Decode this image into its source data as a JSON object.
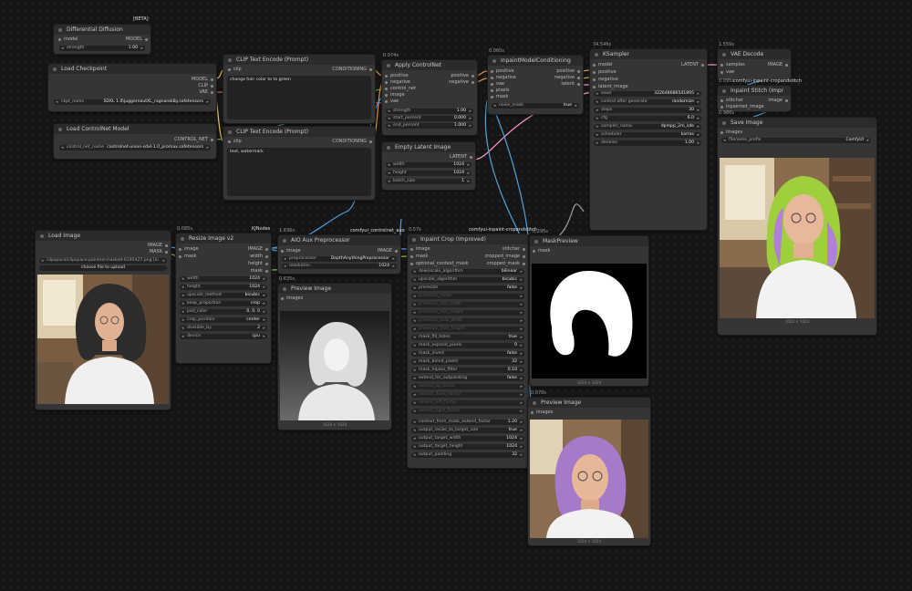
{
  "canvas": {
    "background": "#161616"
  },
  "beta_tag": "[BETA]",
  "tags": {
    "controlnet_node": "ControlNet",
    "kjnodes": "KJNodes",
    "comfyui_controlnet_aux": "comfyui_controlnet_aux",
    "comfyui_inpaint_cropandstitch": "comfyui-inpaint-cropandstitch",
    "comfyui_inpaint_cropandstitch_2": "comfyui-inpaint-cropandstitch"
  },
  "timings": {
    "resize": "0.085s",
    "aio": "1.836s",
    "inpaint_crop": "0.57s",
    "mask_preview": "0.295s",
    "preview_image": "0.635s",
    "ksampler": "34.546s",
    "vae_decode": "1.559s",
    "stitch": "0.095s",
    "save": "0.986s",
    "apply_cn": "0.074s",
    "inpaint_cond": "0.060s",
    "preview_bottom": "0.070s"
  },
  "nodes": {
    "differential": {
      "title": "Differential Diffusion",
      "in_model": "model",
      "out_model": "MODEL",
      "strength_label": "strength",
      "strength_value": "1.00"
    },
    "load_checkpoint": {
      "title": "Load Checkpoint",
      "out_model": "MODEL",
      "out_clip": "CLIP",
      "out_vae": "VAE",
      "ckpt_label": "ckpt_name",
      "ckpt_value": "SDXL 1.0\\juggernautXL_ragnarokBy.safetensors"
    },
    "load_controlnet": {
      "title": "Load ControlNet Model",
      "out": "CONTROL_NET",
      "label": "control_net_name",
      "value": "controlnet-union-sdxl-1.0_promax.safetensors"
    },
    "clip_pos": {
      "title": "CLIP Text Encode (Prompt)",
      "in_clip": "clip",
      "out": "CONDITIONING",
      "text": "change hair color to to green"
    },
    "clip_neg": {
      "title": "CLIP Text Encode (Prompt)",
      "in_clip": "clip",
      "out": "CONDITIONING",
      "text": "text, watermark"
    },
    "apply_cn": {
      "title": "Apply ControlNet",
      "in_positive": "positive",
      "in_negative": "negative",
      "in_control_net": "control_net",
      "in_image": "image",
      "in_vae": "vae",
      "out_positive": "positive",
      "out_negative": "negative",
      "strength_label": "strength",
      "strength_value": "1.00",
      "start_label": "start_percent",
      "start_value": "0.000",
      "end_label": "end_percent",
      "end_value": "1.000"
    },
    "empty_latent": {
      "title": "Empty Latent Image",
      "out": "LATENT",
      "width_label": "width",
      "width_value": "1024",
      "height_label": "height",
      "height_value": "1024",
      "batch_label": "batch_size",
      "batch_value": "1"
    },
    "inpaint_cond": {
      "title": "InpaintModelConditioning",
      "in_positive": "positive",
      "in_negative": "negative",
      "in_vae": "vae",
      "in_pixels": "pixels",
      "in_mask": "mask",
      "out_positive": "positive",
      "out_negative": "negative",
      "out_latent": "latent",
      "noise_label": "noise_mask",
      "noise_value": "true"
    },
    "ksampler": {
      "title": "KSampler",
      "in_model": "model",
      "in_positive": "positive",
      "in_negative": "negative",
      "in_latent": "latent_image",
      "out": "LATENT",
      "rows": [
        {
          "label": "seed",
          "value": "322648686541895"
        },
        {
          "label": "control after generate",
          "value": "randomize"
        },
        {
          "label": "steps",
          "value": "30"
        },
        {
          "label": "cfg",
          "value": "6.0"
        },
        {
          "label": "sampler_name",
          "value": "dpmpp_2m_sde"
        },
        {
          "label": "scheduler",
          "value": "karras"
        },
        {
          "label": "denoise",
          "value": "1.00"
        }
      ]
    },
    "vae_decode": {
      "title": "VAE Decode",
      "in_samples": "samples",
      "in_vae": "vae",
      "out": "IMAGE"
    },
    "stitch": {
      "title": "Inpaint Stitch (Impr",
      "in_stitcher": "stitcher",
      "in_inpainted": "inpainted_image",
      "out": "image"
    },
    "save": {
      "title": "Save Image",
      "in_images": "images",
      "prefix_label": "filename_prefix",
      "prefix_value": "ComfyUI"
    },
    "load_image": {
      "title": "Load Image",
      "out_image": "IMAGE",
      "out_mask": "MASK",
      "file_value": "clipspace/clipspace-painted-masked-6195427.png [in",
      "upload_label": "choose file to upload",
      "caption": "1024 × 1024"
    },
    "resize": {
      "title": "Resize Image v2",
      "in_image": "image",
      "in_mask": "mask",
      "out_image": "IMAGE",
      "out_width": "width",
      "out_height": "height",
      "out_mask": "mask",
      "rows": [
        {
          "label": "width",
          "value": "1024"
        },
        {
          "label": "height",
          "value": "1024"
        },
        {
          "label": "upscale_method",
          "value": "bicubic"
        },
        {
          "label": "keep_proportion",
          "value": "crop"
        },
        {
          "label": "pad_color",
          "value": "0, 0, 0"
        },
        {
          "label": "crop_position",
          "value": "center"
        },
        {
          "label": "divisible_by",
          "value": "2"
        },
        {
          "label": "device",
          "value": "cpu"
        }
      ]
    },
    "aio": {
      "title": "AIO Aux Preprocessor",
      "in_image": "image",
      "out": "IMAGE",
      "pre_label": "preprocessor",
      "pre_value": "DepthAnythingPreprocessor",
      "res_label": "resolution",
      "res_value": "1024"
    },
    "preview_depth": {
      "title": "Preview Image",
      "in_images": "images",
      "caption": "1024 × 1024"
    },
    "inpaint_crop": {
      "title": "Inpaint Crop (Improved)",
      "in_image": "image",
      "in_mask": "mask",
      "in_opt": "optional_context_mask",
      "out_stitcher": "stitcher",
      "out_cropped_image": "cropped_image",
      "out_cropped_mask": "cropped_mask",
      "rows": [
        {
          "label": "downscale_algorithm",
          "value": "bilinear",
          "off": false
        },
        {
          "label": "upscale_algorithm",
          "value": "bicubic",
          "off": false
        },
        {
          "label": "preresize",
          "value": "false",
          "off": false
        },
        {
          "label": "preresize_mode",
          "value": "",
          "off": true
        },
        {
          "label": "preresize_min_width",
          "value": "",
          "off": true
        },
        {
          "label": "preresize_min_height",
          "value": "",
          "off": true
        },
        {
          "label": "preresize_max_width",
          "value": "",
          "off": true
        },
        {
          "label": "preresize_max_height",
          "value": "",
          "off": true
        },
        {
          "label": "mask_fill_holes",
          "value": "true",
          "off": false
        },
        {
          "label": "mask_expand_pixels",
          "value": "0",
          "off": false
        },
        {
          "label": "mask_invert",
          "value": "false",
          "off": false
        },
        {
          "label": "mask_blend_pixels",
          "value": "32",
          "off": false
        },
        {
          "label": "mask_hipass_filter",
          "value": "0.10",
          "off": false
        },
        {
          "label": "extend_for_outpainting",
          "value": "false",
          "off": false
        },
        {
          "label": "extend_up_factor",
          "value": "",
          "off": true
        },
        {
          "label": "extend_down_factor",
          "value": "",
          "off": true
        },
        {
          "label": "extend_left_factor",
          "value": "",
          "off": true
        },
        {
          "label": "extend_right_factor",
          "value": "",
          "off": true
        },
        {
          "label": "context_from_mask_extend_factor",
          "value": "1.20",
          "off": false
        },
        {
          "label": "output_resize_to_target_size",
          "value": "true",
          "off": false
        },
        {
          "label": "output_target_width",
          "value": "1024",
          "off": false
        },
        {
          "label": "output_target_height",
          "value": "1024",
          "off": false
        },
        {
          "label": "output_padding",
          "value": "32",
          "off": false
        }
      ]
    },
    "mask_preview": {
      "title": "MaskPreview",
      "in_mask": "mask",
      "caption": "1024 × 1024"
    },
    "preview_bottom": {
      "title": "Preview Image",
      "in_images": "images",
      "caption": "1024 × 1024"
    }
  }
}
